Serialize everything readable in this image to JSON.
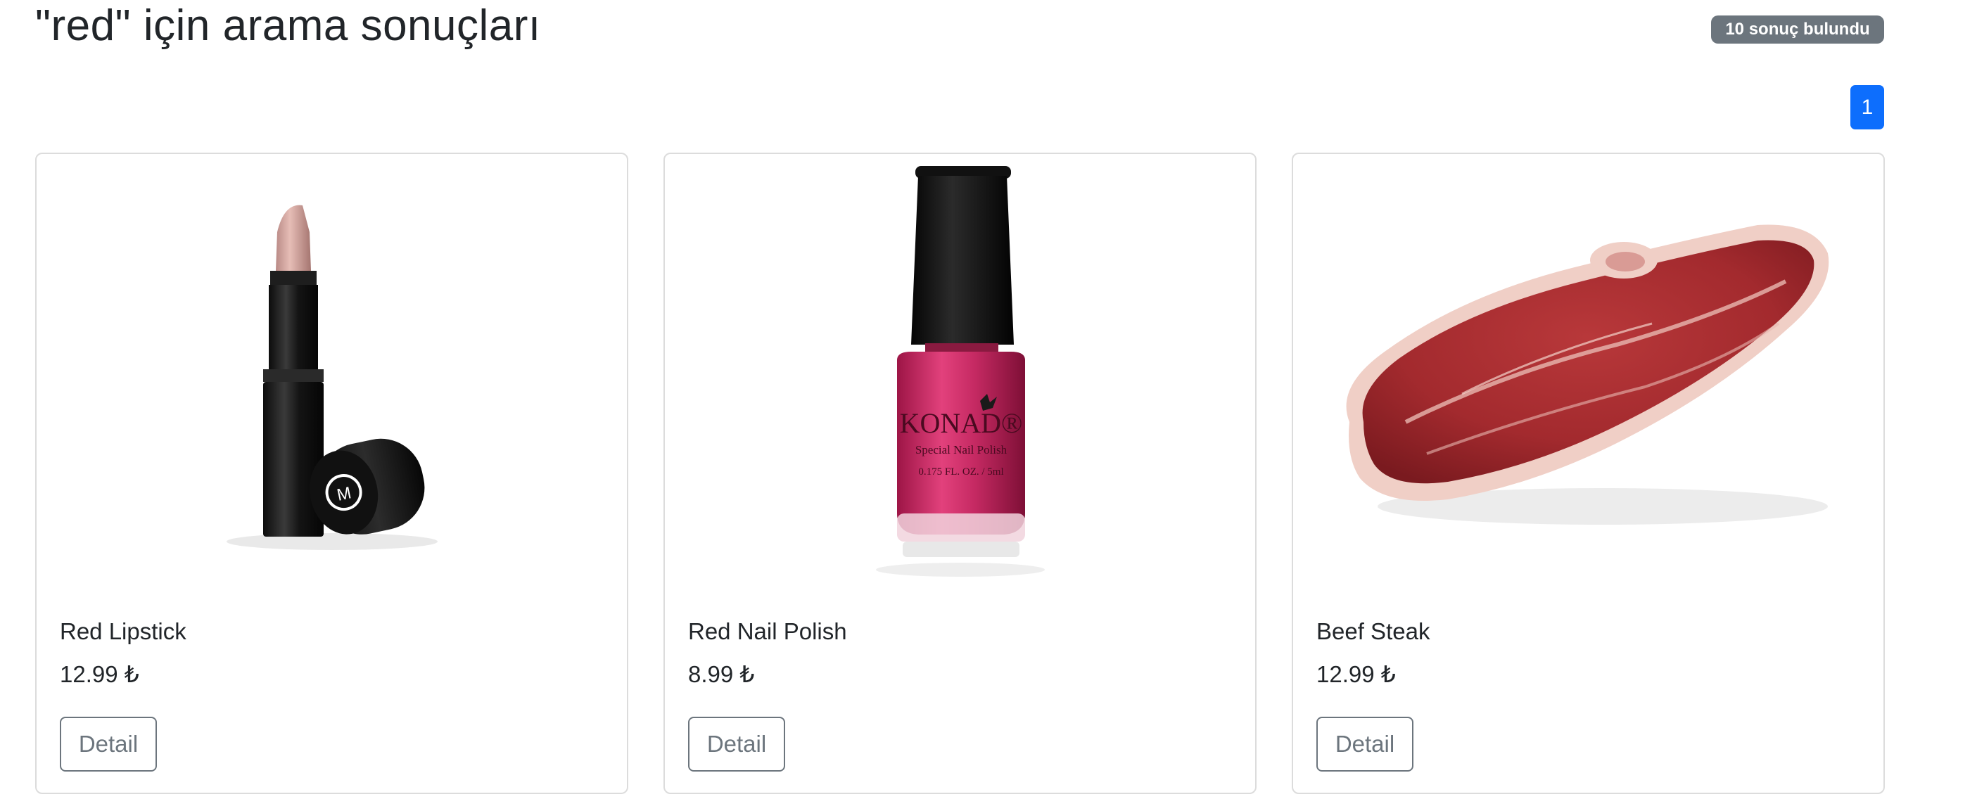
{
  "header": {
    "title": "\"red\" için arama sonuçları",
    "result_count": "10 sonuç bulundu"
  },
  "pagination": {
    "pages": [
      "1"
    ],
    "active_color": "#0d6efd"
  },
  "products": [
    {
      "name": "Red Lipstick",
      "price": "12.99 ₺",
      "button": "Detail",
      "image": "lipstick-image",
      "image_text": "M"
    },
    {
      "name": "Red Nail Polish",
      "price": "8.99 ₺",
      "button": "Detail",
      "image": "nail-polish-image",
      "image_text": "KONAD®",
      "image_subtext": "Special Nail Polish",
      "image_size": "0.175 FL. OZ. / 5ml"
    },
    {
      "name": "Beef Steak",
      "price": "12.99 ₺",
      "button": "Detail",
      "image": "steak-image"
    }
  ]
}
